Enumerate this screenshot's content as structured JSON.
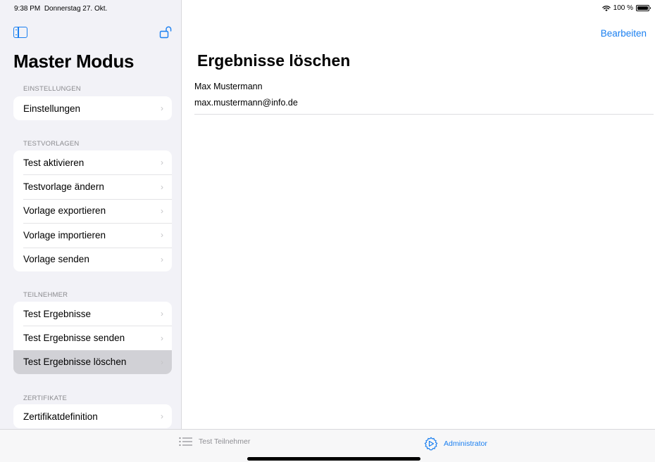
{
  "status": {
    "time": "9:38 PM",
    "date": "Donnerstag 27. Okt.",
    "battery": "100 %",
    "battery_level": 1.0
  },
  "sidebar": {
    "title": "Master Modus",
    "sections": [
      {
        "header": "EINSTELLUNGEN",
        "items": [
          {
            "label": "Einstellungen"
          }
        ]
      },
      {
        "header": "TESTVORLAGEN",
        "items": [
          {
            "label": "Test aktivieren"
          },
          {
            "label": "Testvorlage ändern"
          },
          {
            "label": "Vorlage exportieren"
          },
          {
            "label": "Vorlage importieren"
          },
          {
            "label": "Vorlage senden"
          }
        ]
      },
      {
        "header": "TEILNEHMER",
        "items": [
          {
            "label": "Test Ergebnisse"
          },
          {
            "label": "Test Ergebnisse senden"
          },
          {
            "label": "Test Ergebnisse löschen",
            "selected": true
          }
        ]
      },
      {
        "header": "ZERTIFIKATE",
        "items": [
          {
            "label": "Zertifikatdefinition"
          }
        ]
      }
    ],
    "chevron": "›"
  },
  "main": {
    "edit_label": "Bearbeiten",
    "title": "Ergebnisse löschen",
    "result": {
      "name": "Max Mustermann",
      "email": "max.mustermann@info.de"
    }
  },
  "tabbar": {
    "tabs": [
      {
        "label": "Test Teilnehmer",
        "icon": "list-icon",
        "active": false
      },
      {
        "label": "Administrator",
        "icon": "gear-icon",
        "active": true
      }
    ]
  },
  "colors": {
    "accent": "#1a7ff0",
    "sidebar_bg": "#f2f2f7",
    "selected_row": "#d1d1d6"
  }
}
